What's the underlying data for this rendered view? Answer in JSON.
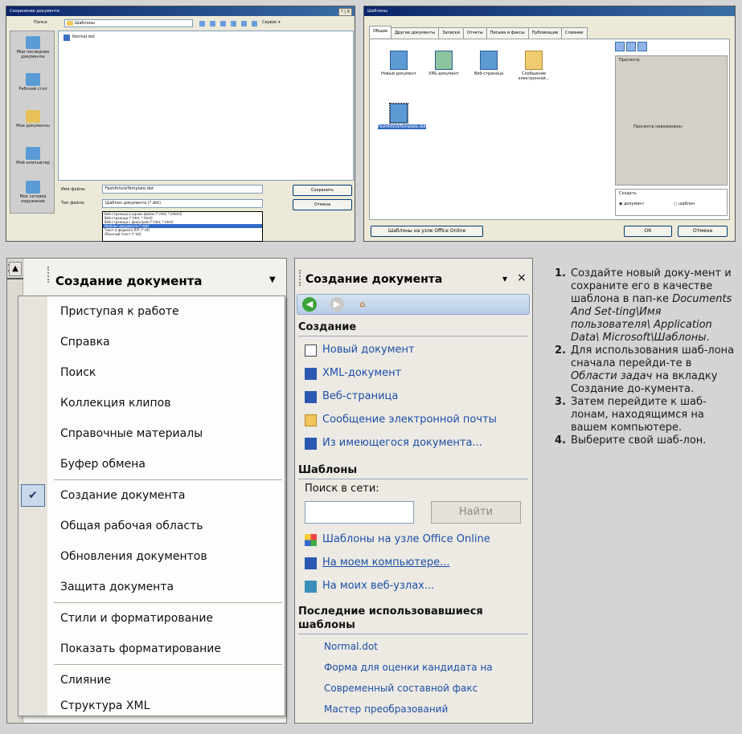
{
  "save_dialog": {
    "title": "Сохранение документа",
    "title_buttons": "? | X",
    "folder_label": "Папка:",
    "folder_value": "Шаблоны",
    "service_label": "Сервис ▾",
    "files": [
      "Normal.dot"
    ],
    "places": [
      "Мои последние документы",
      "Рабочий стол",
      "Мои документы",
      "Мой компьютер",
      "Мое сетевое окружение"
    ],
    "filename_label": "Имя файла:",
    "filename_value": "FashArticleTemplate.dot",
    "filetype_label": "Тип файла:",
    "filetype_value": "Шаблон документа (*.dot)",
    "save_button": "Сохранить",
    "cancel_button": "Отмена",
    "type_options": [
      "Веб-страница в одном файле (*.mht; *.mhtml)",
      "Веб-страница (*.htm; *.html)",
      "Веб-страница с фильтром (*.htm; *.html)",
      "Шаблон документа (*.dot)",
      "Текст в формате RTF (*.rtf)",
      "Обычный текст (*.txt)"
    ]
  },
  "templates_dialog": {
    "title": "Шаблоны",
    "tabs": [
      "Общие",
      "Другие документы",
      "Записки",
      "Отчеты",
      "Письма и факсы",
      "Публикации",
      "Слияние"
    ],
    "items": [
      "Новый документ",
      "XML-документ",
      "Веб-страница",
      "Сообщение электронной...",
      "FashArticleTemplate.dot"
    ],
    "preview_label": "Просмотр",
    "preview_text": "Просмотр невозможен.",
    "create_label": "Создать",
    "radio_document": "документ",
    "radio_template": "шаблон",
    "online_button": "Шаблоны на узле Office Online",
    "ok_button": "ОК",
    "cancel_button": "Отмена"
  },
  "menu_panel": {
    "cut_number": "3",
    "header_title": "Создание документа",
    "items": [
      "Приступая к работе",
      "Справка",
      "Поиск",
      "Коллекция клипов",
      "Справочные материалы",
      "Буфер обмена",
      "Создание документа",
      "Общая рабочая область",
      "Обновления документов",
      "Защита документа",
      "Стили и форматирование",
      "Показать форматирование",
      "Слияние",
      "Структура XML"
    ],
    "checked_item": "Создание документа"
  },
  "task_pane": {
    "title": "Создание документа",
    "dropdown_glyph": "▾",
    "close_glyph": "×",
    "section_create": "Создание",
    "create_links": [
      "Новый документ",
      "XML-документ",
      "Веб-страница",
      "Сообщение электронной почты",
      "Из имеющегося документа..."
    ],
    "section_templates": "Шаблоны",
    "search_label": "Поиск в сети:",
    "find_button": "Найти",
    "template_links": [
      "Шаблоны на узле Office Online",
      "На моем компьютере...",
      "На моих веб-узлах..."
    ],
    "section_recent_1": "Последние использовавшиеся",
    "section_recent_2": "шаблоны",
    "recent_links": [
      "Normal.dot",
      "Форма для оценки кандидата на",
      "Современный составной факс",
      "Мастер преобразований"
    ]
  },
  "instructions": {
    "items": [
      {
        "num": "1.",
        "text": "Создайте новый доку-мент и сохраните его в качестве шаблона в пап-ке ",
        "path": "Documents And Set-ting\\Имя пользователя\\ Application Data\\ Microsoft\\Шаблоны",
        "tail": "."
      },
      {
        "num": "2.",
        "text": "Для использования шаб-лона сначала перейди-те в ",
        "path": "Области задач",
        "tail": " на вкладку Создание до-кумента."
      },
      {
        "num": "3.",
        "text": "Затем перейдите к шаб-лонам, находящимся на вашем компьютере.",
        "path": "",
        "tail": ""
      },
      {
        "num": "4.",
        "text": "Выберите свой шаб-лон.",
        "path": "",
        "tail": ""
      }
    ]
  },
  "colors": {
    "link": "#1d4ea8",
    "xp_title": "#0a246a",
    "selection": "#316ac5"
  },
  "icons": [
    "back-arrow-icon",
    "forward-arrow-icon",
    "home-icon",
    "new-document-icon",
    "word-document-icon",
    "envelope-icon",
    "check-icon",
    "folder-icon"
  ]
}
